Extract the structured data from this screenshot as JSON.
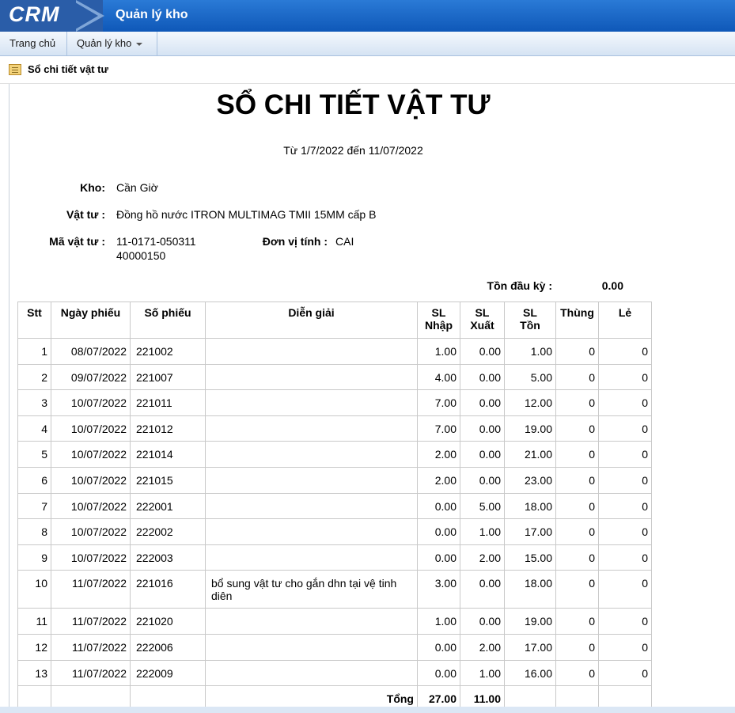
{
  "app": {
    "logo": "CRM",
    "title": "Quản lý kho"
  },
  "menu": {
    "home": "Trang chủ",
    "warehouse": "Quản lý kho"
  },
  "page": {
    "title": "Sổ chi tiết vật tư"
  },
  "report": {
    "title": "SỔ CHI TIẾT VẬT TƯ",
    "date_range": "Từ 1/7/2022 đến 11/07/2022",
    "labels": {
      "kho": "Kho:",
      "vat_tu": "Vật tư :",
      "ma_vat_tu": "Mã vật tư :",
      "don_vi_tinh": "Đơn vị tính :",
      "ton_dau_ky": "Tồn đầu kỳ :"
    },
    "values": {
      "kho": "Cần Giờ",
      "vat_tu": "Đồng hồ nước ITRON MULTIMAG TMII 15MM cấp B",
      "ma_vat_tu_line1": "11-0171-050311",
      "ma_vat_tu_line2": "40000150",
      "don_vi_tinh": "CAI",
      "ton_dau_ky": "0.00"
    }
  },
  "table": {
    "headers": {
      "stt": "Stt",
      "ngay_phieu": "Ngày phiếu",
      "so_phieu": "Số phiếu",
      "dien_giai": "Diễn giải",
      "sl_nhap_1": "SL",
      "sl_nhap_2": "Nhập",
      "sl_xuat_1": "SL",
      "sl_xuat_2": "Xuất",
      "sl_ton_1": "SL",
      "sl_ton_2": "Tồn",
      "thung": "Thùng",
      "le": "Lẻ"
    },
    "rows": [
      {
        "stt": "1",
        "ngay": "08/07/2022",
        "so": "221002",
        "dien_giai": "",
        "nhap": "1.00",
        "xuat": "0.00",
        "ton": "1.00",
        "thung": "0",
        "le": "0"
      },
      {
        "stt": "2",
        "ngay": "09/07/2022",
        "so": "221007",
        "dien_giai": "",
        "nhap": "4.00",
        "xuat": "0.00",
        "ton": "5.00",
        "thung": "0",
        "le": "0"
      },
      {
        "stt": "3",
        "ngay": "10/07/2022",
        "so": "221011",
        "dien_giai": "",
        "nhap": "7.00",
        "xuat": "0.00",
        "ton": "12.00",
        "thung": "0",
        "le": "0"
      },
      {
        "stt": "4",
        "ngay": "10/07/2022",
        "so": "221012",
        "dien_giai": "",
        "nhap": "7.00",
        "xuat": "0.00",
        "ton": "19.00",
        "thung": "0",
        "le": "0"
      },
      {
        "stt": "5",
        "ngay": "10/07/2022",
        "so": "221014",
        "dien_giai": "",
        "nhap": "2.00",
        "xuat": "0.00",
        "ton": "21.00",
        "thung": "0",
        "le": "0"
      },
      {
        "stt": "6",
        "ngay": "10/07/2022",
        "so": "221015",
        "dien_giai": "",
        "nhap": "2.00",
        "xuat": "0.00",
        "ton": "23.00",
        "thung": "0",
        "le": "0"
      },
      {
        "stt": "7",
        "ngay": "10/07/2022",
        "so": "222001",
        "dien_giai": "",
        "nhap": "0.00",
        "xuat": "5.00",
        "ton": "18.00",
        "thung": "0",
        "le": "0"
      },
      {
        "stt": "8",
        "ngay": "10/07/2022",
        "so": "222002",
        "dien_giai": "",
        "nhap": "0.00",
        "xuat": "1.00",
        "ton": "17.00",
        "thung": "0",
        "le": "0"
      },
      {
        "stt": "9",
        "ngay": "10/07/2022",
        "so": "222003",
        "dien_giai": "",
        "nhap": "0.00",
        "xuat": "2.00",
        "ton": "15.00",
        "thung": "0",
        "le": "0"
      },
      {
        "stt": "10",
        "ngay": "11/07/2022",
        "so": "221016",
        "dien_giai": "bổ sung vật tư cho gắn dhn tại vệ tinh diên",
        "nhap": "3.00",
        "xuat": "0.00",
        "ton": "18.00",
        "thung": "0",
        "le": "0"
      },
      {
        "stt": "11",
        "ngay": "11/07/2022",
        "so": "221020",
        "dien_giai": "",
        "nhap": "1.00",
        "xuat": "0.00",
        "ton": "19.00",
        "thung": "0",
        "le": "0"
      },
      {
        "stt": "12",
        "ngay": "11/07/2022",
        "so": "222006",
        "dien_giai": "",
        "nhap": "0.00",
        "xuat": "2.00",
        "ton": "17.00",
        "thung": "0",
        "le": "0"
      },
      {
        "stt": "13",
        "ngay": "11/07/2022",
        "so": "222009",
        "dien_giai": "",
        "nhap": "0.00",
        "xuat": "1.00",
        "ton": "16.00",
        "thung": "0",
        "le": "0"
      }
    ],
    "total": {
      "label": "Tổng",
      "nhap": "27.00",
      "xuat": "11.00"
    }
  }
}
